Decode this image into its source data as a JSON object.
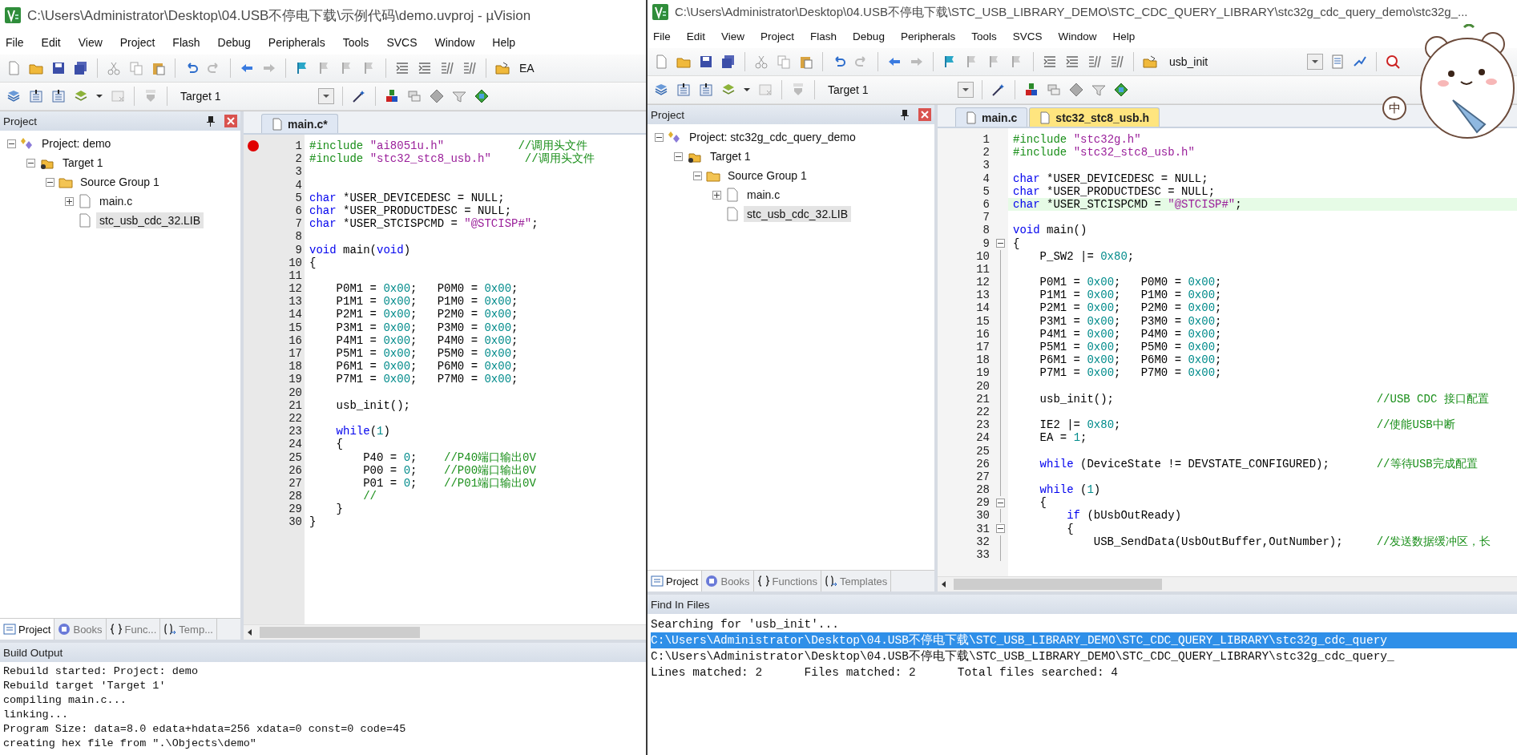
{
  "left_window": {
    "title": "C:\\Users\\Administrator\\Desktop\\04.USB不停电下载\\示例代码\\demo.uvproj - µVision",
    "menu": [
      "File",
      "Edit",
      "View",
      "Project",
      "Flash",
      "Debug",
      "Peripherals",
      "Tools",
      "SVCS",
      "Window",
      "Help"
    ],
    "find_text": "EA",
    "target": "Target 1",
    "project_panel": {
      "title": "Project",
      "tree": [
        {
          "label": "Project: demo",
          "kind": "project",
          "expanded": true,
          "selected": false,
          "children": [
            {
              "label": "Target 1",
              "kind": "target",
              "expanded": true,
              "selected": false,
              "children": [
                {
                  "label": "Source Group 1",
                  "kind": "group",
                  "expanded": true,
                  "selected": false,
                  "children": [
                    {
                      "label": "main.c",
                      "kind": "file",
                      "expanded": false,
                      "selected": false
                    },
                    {
                      "label": "stc_usb_cdc_32.LIB",
                      "kind": "file",
                      "selected": true
                    }
                  ]
                }
              ]
            }
          ]
        }
      ],
      "tabs": [
        {
          "label": "Project",
          "kind": "project",
          "selected": true
        },
        {
          "label": "Books",
          "kind": "books",
          "selected": false
        },
        {
          "label": "Func...",
          "kind": "functions",
          "selected": false
        },
        {
          "label": "Temp...",
          "kind": "templates",
          "selected": false
        }
      ]
    },
    "editor": {
      "tabs": [
        {
          "label": "main.c*",
          "selected": true
        }
      ],
      "lines": [
        {
          "n": "1",
          "breakpoint": true,
          "segs": [
            {
              "kind": "preprocessor",
              "text": "#include "
            },
            {
              "kind": "string",
              "text": "\"ai8051u.h\""
            },
            {
              "kind": "comment",
              "text": "           //调用头文件"
            }
          ]
        },
        {
          "n": "2",
          "breakpoint": false,
          "segs": [
            {
              "kind": "preprocessor",
              "text": "#include "
            },
            {
              "kind": "string",
              "text": "\"stc32_stc8_usb.h\""
            },
            {
              "kind": "comment",
              "text": "     //调用头文件"
            }
          ]
        },
        {
          "n": "3",
          "breakpoint": false
        },
        {
          "n": "4",
          "breakpoint": false
        },
        {
          "n": "5",
          "breakpoint": false,
          "segs": [
            {
              "kind": "keyword",
              "text": "char"
            },
            {
              "kind": "plain",
              "text": " *USER_DEVICEDESC = NULL;"
            }
          ]
        },
        {
          "n": "6",
          "breakpoint": false,
          "segs": [
            {
              "kind": "keyword",
              "text": "char"
            },
            {
              "kind": "plain",
              "text": " *USER_PRODUCTDESC = NULL;"
            }
          ]
        },
        {
          "n": "7",
          "breakpoint": false,
          "segs": [
            {
              "kind": "keyword",
              "text": "char"
            },
            {
              "kind": "plain",
              "text": " *USER_STCISPCMD = "
            },
            {
              "kind": "string",
              "text": "\"@STCISP#\""
            },
            {
              "kind": "plain",
              "text": ";"
            }
          ]
        },
        {
          "n": "8",
          "breakpoint": false
        },
        {
          "n": "9",
          "breakpoint": false,
          "segs": [
            {
              "kind": "keyword",
              "text": "void"
            },
            {
              "kind": "plain",
              "text": " main("
            },
            {
              "kind": "keyword",
              "text": "void"
            },
            {
              "kind": "plain",
              "text": ")"
            }
          ]
        },
        {
          "n": "10",
          "breakpoint": false,
          "segs": [
            {
              "kind": "plain",
              "text": "{"
            }
          ]
        },
        {
          "n": "11",
          "breakpoint": false
        },
        {
          "n": "12",
          "breakpoint": false,
          "segs": [
            {
              "kind": "plain",
              "text": "    P0M1 = "
            },
            {
              "kind": "number",
              "text": "0x00"
            },
            {
              "kind": "plain",
              "text": ";   P0M0 = "
            },
            {
              "kind": "number",
              "text": "0x00"
            },
            {
              "kind": "plain",
              "text": ";"
            }
          ]
        },
        {
          "n": "13",
          "breakpoint": false,
          "segs": [
            {
              "kind": "plain",
              "text": "    P1M1 = "
            },
            {
              "kind": "number",
              "text": "0x00"
            },
            {
              "kind": "plain",
              "text": ";   P1M0 = "
            },
            {
              "kind": "number",
              "text": "0x00"
            },
            {
              "kind": "plain",
              "text": ";"
            }
          ]
        },
        {
          "n": "14",
          "breakpoint": false,
          "segs": [
            {
              "kind": "plain",
              "text": "    P2M1 = "
            },
            {
              "kind": "number",
              "text": "0x00"
            },
            {
              "kind": "plain",
              "text": ";   P2M0 = "
            },
            {
              "kind": "number",
              "text": "0x00"
            },
            {
              "kind": "plain",
              "text": ";"
            }
          ]
        },
        {
          "n": "15",
          "breakpoint": false,
          "segs": [
            {
              "kind": "plain",
              "text": "    P3M1 = "
            },
            {
              "kind": "number",
              "text": "0x00"
            },
            {
              "kind": "plain",
              "text": ";   P3M0 = "
            },
            {
              "kind": "number",
              "text": "0x00"
            },
            {
              "kind": "plain",
              "text": ";"
            }
          ]
        },
        {
          "n": "16",
          "breakpoint": false,
          "segs": [
            {
              "kind": "plain",
              "text": "    P4M1 = "
            },
            {
              "kind": "number",
              "text": "0x00"
            },
            {
              "kind": "plain",
              "text": ";   P4M0 = "
            },
            {
              "kind": "number",
              "text": "0x00"
            },
            {
              "kind": "plain",
              "text": ";"
            }
          ]
        },
        {
          "n": "17",
          "breakpoint": false,
          "segs": [
            {
              "kind": "plain",
              "text": "    P5M1 = "
            },
            {
              "kind": "number",
              "text": "0x00"
            },
            {
              "kind": "plain",
              "text": ";   P5M0 = "
            },
            {
              "kind": "number",
              "text": "0x00"
            },
            {
              "kind": "plain",
              "text": ";"
            }
          ]
        },
        {
          "n": "18",
          "breakpoint": false,
          "segs": [
            {
              "kind": "plain",
              "text": "    P6M1 = "
            },
            {
              "kind": "number",
              "text": "0x00"
            },
            {
              "kind": "plain",
              "text": ";   P6M0 = "
            },
            {
              "kind": "number",
              "text": "0x00"
            },
            {
              "kind": "plain",
              "text": ";"
            }
          ]
        },
        {
          "n": "19",
          "breakpoint": false,
          "segs": [
            {
              "kind": "plain",
              "text": "    P7M1 = "
            },
            {
              "kind": "number",
              "text": "0x00"
            },
            {
              "kind": "plain",
              "text": ";   P7M0 = "
            },
            {
              "kind": "number",
              "text": "0x00"
            },
            {
              "kind": "plain",
              "text": ";"
            }
          ]
        },
        {
          "n": "20",
          "breakpoint": false
        },
        {
          "n": "21",
          "breakpoint": false,
          "segs": [
            {
              "kind": "plain",
              "text": "    usb_init();"
            }
          ]
        },
        {
          "n": "22",
          "breakpoint": false
        },
        {
          "n": "23",
          "breakpoint": false,
          "segs": [
            {
              "kind": "keyword",
              "text": "    while"
            },
            {
              "kind": "plain",
              "text": "("
            },
            {
              "kind": "number",
              "text": "1"
            },
            {
              "kind": "plain",
              "text": ")"
            }
          ]
        },
        {
          "n": "24",
          "breakpoint": false,
          "segs": [
            {
              "kind": "plain",
              "text": "    {"
            }
          ]
        },
        {
          "n": "25",
          "breakpoint": false,
          "segs": [
            {
              "kind": "plain",
              "text": "        P40 = "
            },
            {
              "kind": "number",
              "text": "0"
            },
            {
              "kind": "plain",
              "text": ";"
            },
            {
              "kind": "comment",
              "text": "    //P40端口输出0V"
            }
          ]
        },
        {
          "n": "26",
          "breakpoint": false,
          "segs": [
            {
              "kind": "plain",
              "text": "        P00 = "
            },
            {
              "kind": "number",
              "text": "0"
            },
            {
              "kind": "plain",
              "text": ";"
            },
            {
              "kind": "comment",
              "text": "    //P00端口输出0V"
            }
          ]
        },
        {
          "n": "27",
          "breakpoint": false,
          "segs": [
            {
              "kind": "plain",
              "text": "        P01 = "
            },
            {
              "kind": "number",
              "text": "0"
            },
            {
              "kind": "plain",
              "text": ";"
            },
            {
              "kind": "comment",
              "text": "    //P01端口输出0V"
            }
          ]
        },
        {
          "n": "28",
          "breakpoint": false,
          "segs": [
            {
              "kind": "comment",
              "text": "        //"
            }
          ]
        },
        {
          "n": "29",
          "breakpoint": false,
          "segs": [
            {
              "kind": "plain",
              "text": "    }"
            }
          ]
        },
        {
          "n": "30",
          "breakpoint": false,
          "segs": [
            {
              "kind": "plain",
              "text": "}"
            }
          ]
        }
      ]
    },
    "build_output": {
      "title": "Build Output",
      "lines": [
        "Rebuild started: Project: demo",
        "Rebuild target 'Target 1'",
        "compiling main.c...",
        "linking...",
        "Program Size: data=8.0 edata+hdata=256 xdata=0 const=0 code=45",
        "creating hex file from \".\\Objects\\demo\""
      ]
    }
  },
  "right_window": {
    "title": "C:\\Users\\Administrator\\Desktop\\04.USB不停电下载\\STC_USB_LIBRARY_DEMO\\STC_CDC_QUERY_LIBRARY\\stc32g_cdc_query_demo\\stc32g_...",
    "menu": [
      "File",
      "Edit",
      "View",
      "Project",
      "Flash",
      "Debug",
      "Peripherals",
      "Tools",
      "SVCS",
      "Window",
      "Help"
    ],
    "find_text": "usb_init",
    "target": "Target 1",
    "project_panel": {
      "title": "Project",
      "tree": [
        {
          "label": "Project: stc32g_cdc_query_demo",
          "kind": "project",
          "expanded": true,
          "selected": false,
          "children": [
            {
              "label": "Target 1",
              "kind": "target",
              "expanded": true,
              "selected": false,
              "children": [
                {
                  "label": "Source Group 1",
                  "kind": "group",
                  "expanded": true,
                  "selected": false,
                  "children": [
                    {
                      "label": "main.c",
                      "kind": "file",
                      "expanded": false,
                      "selected": false
                    },
                    {
                      "label": "stc_usb_cdc_32.LIB",
                      "kind": "file",
                      "selected": true
                    }
                  ]
                }
              ]
            }
          ]
        }
      ],
      "tabs": [
        {
          "label": "Project",
          "kind": "project",
          "selected": true
        },
        {
          "label": "Books",
          "kind": "books",
          "selected": false
        },
        {
          "label": "Functions",
          "kind": "functions",
          "selected": false
        },
        {
          "label": "Templates",
          "kind": "templates",
          "selected": false
        }
      ]
    },
    "editor": {
      "tabs": [
        {
          "label": "main.c",
          "selected": true
        },
        {
          "label": "stc32_stc8_usb.h",
          "selected": false
        }
      ],
      "lines": [
        {
          "n": "1",
          "fold": false,
          "current": false,
          "segs": [
            {
              "kind": "preprocessor",
              "text": "#include "
            },
            {
              "kind": "string",
              "text": "\"stc32g.h\""
            }
          ]
        },
        {
          "n": "2",
          "fold": false,
          "current": false,
          "segs": [
            {
              "kind": "preprocessor",
              "text": "#include "
            },
            {
              "kind": "string",
              "text": "\"stc32_stc8_usb.h\""
            }
          ]
        },
        {
          "n": "3",
          "fold": false,
          "current": false
        },
        {
          "n": "4",
          "fold": false,
          "current": false,
          "segs": [
            {
              "kind": "keyword",
              "text": "char"
            },
            {
              "kind": "plain",
              "text": " *USER_DEVICEDESC = NULL;"
            }
          ]
        },
        {
          "n": "5",
          "fold": false,
          "current": false,
          "segs": [
            {
              "kind": "keyword",
              "text": "char"
            },
            {
              "kind": "plain",
              "text": " *USER_PRODUCTDESC = NULL;"
            }
          ]
        },
        {
          "n": "6",
          "fold": false,
          "current": true,
          "segs": [
            {
              "kind": "keyword",
              "text": "char"
            },
            {
              "kind": "plain",
              "text": " *USER_STCISPCMD = "
            },
            {
              "kind": "string",
              "text": "\"@STCISP#\""
            },
            {
              "kind": "plain",
              "text": ";"
            }
          ]
        },
        {
          "n": "7",
          "fold": false,
          "current": false
        },
        {
          "n": "8",
          "fold": false,
          "current": false,
          "segs": [
            {
              "kind": "keyword",
              "text": "void"
            },
            {
              "kind": "plain",
              "text": " main()"
            }
          ]
        },
        {
          "n": "9",
          "fold": true,
          "current": false,
          "segs": [
            {
              "kind": "plain",
              "text": "{"
            }
          ]
        },
        {
          "n": "10",
          "fold": false,
          "current": false,
          "segs": [
            {
              "kind": "plain",
              "text": "    P_SW2 |= "
            },
            {
              "kind": "number",
              "text": "0x80"
            },
            {
              "kind": "plain",
              "text": ";"
            }
          ]
        },
        {
          "n": "11",
          "fold": false,
          "current": false
        },
        {
          "n": "12",
          "fold": false,
          "current": false,
          "segs": [
            {
              "kind": "plain",
              "text": "    P0M1 = "
            },
            {
              "kind": "number",
              "text": "0x00"
            },
            {
              "kind": "plain",
              "text": ";   P0M0 = "
            },
            {
              "kind": "number",
              "text": "0x00"
            },
            {
              "kind": "plain",
              "text": ";"
            }
          ]
        },
        {
          "n": "13",
          "fold": false,
          "current": false,
          "segs": [
            {
              "kind": "plain",
              "text": "    P1M1 = "
            },
            {
              "kind": "number",
              "text": "0x00"
            },
            {
              "kind": "plain",
              "text": ";   P1M0 = "
            },
            {
              "kind": "number",
              "text": "0x00"
            },
            {
              "kind": "plain",
              "text": ";"
            }
          ]
        },
        {
          "n": "14",
          "fold": false,
          "current": false,
          "segs": [
            {
              "kind": "plain",
              "text": "    P2M1 = "
            },
            {
              "kind": "number",
              "text": "0x00"
            },
            {
              "kind": "plain",
              "text": ";   P2M0 = "
            },
            {
              "kind": "number",
              "text": "0x00"
            },
            {
              "kind": "plain",
              "text": ";"
            }
          ]
        },
        {
          "n": "15",
          "fold": false,
          "current": false,
          "segs": [
            {
              "kind": "plain",
              "text": "    P3M1 = "
            },
            {
              "kind": "number",
              "text": "0x00"
            },
            {
              "kind": "plain",
              "text": ";   P3M0 = "
            },
            {
              "kind": "number",
              "text": "0x00"
            },
            {
              "kind": "plain",
              "text": ";"
            }
          ]
        },
        {
          "n": "16",
          "fold": false,
          "current": false,
          "segs": [
            {
              "kind": "plain",
              "text": "    P4M1 = "
            },
            {
              "kind": "number",
              "text": "0x00"
            },
            {
              "kind": "plain",
              "text": ";   P4M0 = "
            },
            {
              "kind": "number",
              "text": "0x00"
            },
            {
              "kind": "plain",
              "text": ";"
            }
          ]
        },
        {
          "n": "17",
          "fold": false,
          "current": false,
          "segs": [
            {
              "kind": "plain",
              "text": "    P5M1 = "
            },
            {
              "kind": "number",
              "text": "0x00"
            },
            {
              "kind": "plain",
              "text": ";   P5M0 = "
            },
            {
              "kind": "number",
              "text": "0x00"
            },
            {
              "kind": "plain",
              "text": ";"
            }
          ]
        },
        {
          "n": "18",
          "fold": false,
          "current": false,
          "segs": [
            {
              "kind": "plain",
              "text": "    P6M1 = "
            },
            {
              "kind": "number",
              "text": "0x00"
            },
            {
              "kind": "plain",
              "text": ";   P6M0 = "
            },
            {
              "kind": "number",
              "text": "0x00"
            },
            {
              "kind": "plain",
              "text": ";"
            }
          ]
        },
        {
          "n": "19",
          "fold": false,
          "current": false,
          "segs": [
            {
              "kind": "plain",
              "text": "    P7M1 = "
            },
            {
              "kind": "number",
              "text": "0x00"
            },
            {
              "kind": "plain",
              "text": ";   P7M0 = "
            },
            {
              "kind": "number",
              "text": "0x00"
            },
            {
              "kind": "plain",
              "text": ";"
            }
          ]
        },
        {
          "n": "20",
          "fold": false,
          "current": false
        },
        {
          "n": "21",
          "fold": false,
          "current": false,
          "segs": [
            {
              "kind": "plain",
              "text": "    usb_init();"
            },
            {
              "kind": "comment",
              "text": "                                       //USB CDC 接口配置"
            }
          ]
        },
        {
          "n": "22",
          "fold": false,
          "current": false
        },
        {
          "n": "23",
          "fold": false,
          "current": false,
          "segs": [
            {
              "kind": "plain",
              "text": "    IE2 |= "
            },
            {
              "kind": "number",
              "text": "0x80"
            },
            {
              "kind": "plain",
              "text": ";"
            },
            {
              "kind": "comment",
              "text": "                                      //使能USB中断"
            }
          ]
        },
        {
          "n": "24",
          "fold": false,
          "current": false,
          "segs": [
            {
              "kind": "plain",
              "text": "    EA = "
            },
            {
              "kind": "number",
              "text": "1"
            },
            {
              "kind": "plain",
              "text": ";"
            }
          ]
        },
        {
          "n": "25",
          "fold": false,
          "current": false
        },
        {
          "n": "26",
          "fold": false,
          "current": false,
          "segs": [
            {
              "kind": "keyword",
              "text": "    while"
            },
            {
              "kind": "plain",
              "text": " (DeviceState != DEVSTATE_CONFIGURED);"
            },
            {
              "kind": "comment",
              "text": "       //等待USB完成配置"
            }
          ]
        },
        {
          "n": "27",
          "fold": false,
          "current": false
        },
        {
          "n": "28",
          "fold": false,
          "current": false,
          "segs": [
            {
              "kind": "keyword",
              "text": "    while"
            },
            {
              "kind": "plain",
              "text": " ("
            },
            {
              "kind": "number",
              "text": "1"
            },
            {
              "kind": "plain",
              "text": ")"
            }
          ]
        },
        {
          "n": "29",
          "fold": true,
          "current": false,
          "segs": [
            {
              "kind": "plain",
              "text": "    {"
            }
          ]
        },
        {
          "n": "30",
          "fold": false,
          "current": false,
          "segs": [
            {
              "kind": "keyword",
              "text": "        if"
            },
            {
              "kind": "plain",
              "text": " (bUsbOutReady)"
            }
          ]
        },
        {
          "n": "31",
          "fold": true,
          "current": false,
          "segs": [
            {
              "kind": "plain",
              "text": "        {"
            }
          ]
        },
        {
          "n": "32",
          "fold": false,
          "current": false,
          "segs": [
            {
              "kind": "plain",
              "text": "            USB_SendData(UsbOutBuffer,OutNumber);"
            },
            {
              "kind": "comment",
              "text": "     //发送数据缓冲区，长"
            }
          ]
        },
        {
          "n": "33",
          "fold": false,
          "current": false
        }
      ]
    },
    "find_in_files": {
      "title": "Find In Files",
      "lines": [
        {
          "text": "Searching for 'usb_init'...",
          "selected": false
        },
        {
          "text": "C:\\Users\\Administrator\\Desktop\\04.USB不停电下载\\STC_USB_LIBRARY_DEMO\\STC_CDC_QUERY_LIBRARY\\stc32g_cdc_query",
          "selected": true
        },
        {
          "text": "C:\\Users\\Administrator\\Desktop\\04.USB不停电下载\\STC_USB_LIBRARY_DEMO\\STC_CDC_QUERY_LIBRARY\\stc32g_cdc_query_",
          "selected": false
        },
        {
          "text": "Lines matched: 2      Files matched: 2      Total files searched: 4",
          "selected": false
        }
      ]
    }
  },
  "overlay": {
    "ime_badge": "中"
  }
}
